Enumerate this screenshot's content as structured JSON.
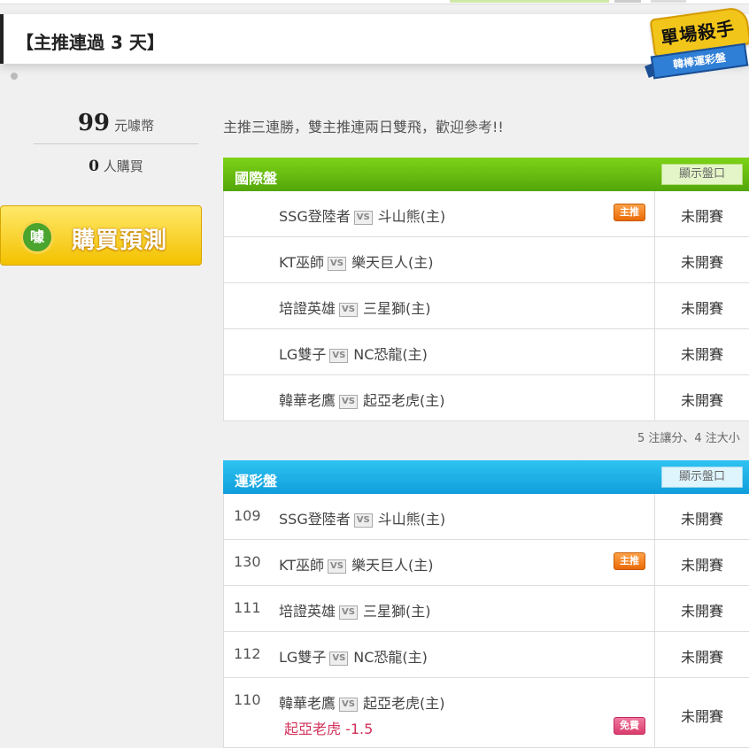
{
  "header": {
    "title": "【主推連過 3 天】"
  },
  "badge": {
    "main": "單場殺手",
    "sub": "韓棒運彩盤"
  },
  "price": {
    "value": "99",
    "unit": "元噱幣"
  },
  "buyers": {
    "count": "0",
    "label": "人購買"
  },
  "buy_button": {
    "icon_text": "噱",
    "label": "購買預測"
  },
  "intro": "主推三連勝，雙主推連兩日雙飛，歡迎參考!!",
  "intl": {
    "name": "國際盤",
    "show_label": "顯示盤口",
    "rows": [
      {
        "away": "SSG登陸者",
        "home": "斗山熊(主)",
        "tag": "主推",
        "status": "未開賽"
      },
      {
        "away": "KT巫師",
        "home": "樂天巨人(主)",
        "tag": "",
        "status": "未開賽"
      },
      {
        "away": "培證英雄",
        "home": "三星獅(主)",
        "tag": "",
        "status": "未開賽"
      },
      {
        "away": "LG雙子",
        "home": "NC恐龍(主)",
        "tag": "",
        "status": "未開賽"
      },
      {
        "away": "韓華老鷹",
        "home": "起亞老虎(主)",
        "tag": "",
        "status": "未開賽"
      }
    ],
    "note": "5 注讓分、4 注大小"
  },
  "lottery": {
    "name": "運彩盤",
    "show_label": "顯示盤口",
    "rows": [
      {
        "code": "109",
        "away": "SSG登陸者",
        "home": "斗山熊(主)",
        "tag": "",
        "status": "未開賽"
      },
      {
        "code": "130",
        "away": "KT巫師",
        "home": "樂天巨人(主)",
        "tag": "主推",
        "status": "未開賽"
      },
      {
        "code": "111",
        "away": "培證英雄",
        "home": "三星獅(主)",
        "tag": "",
        "status": "未開賽"
      },
      {
        "code": "112",
        "away": "LG雙子",
        "home": "NC恐龍(主)",
        "tag": "",
        "status": "未開賽"
      },
      {
        "code": "110",
        "away": "韓華老鷹",
        "home": "起亞老虎(主)",
        "tag": "免費",
        "pick": "起亞老虎 -1.5",
        "status": "未開賽"
      }
    ]
  },
  "vs_label": "VS"
}
